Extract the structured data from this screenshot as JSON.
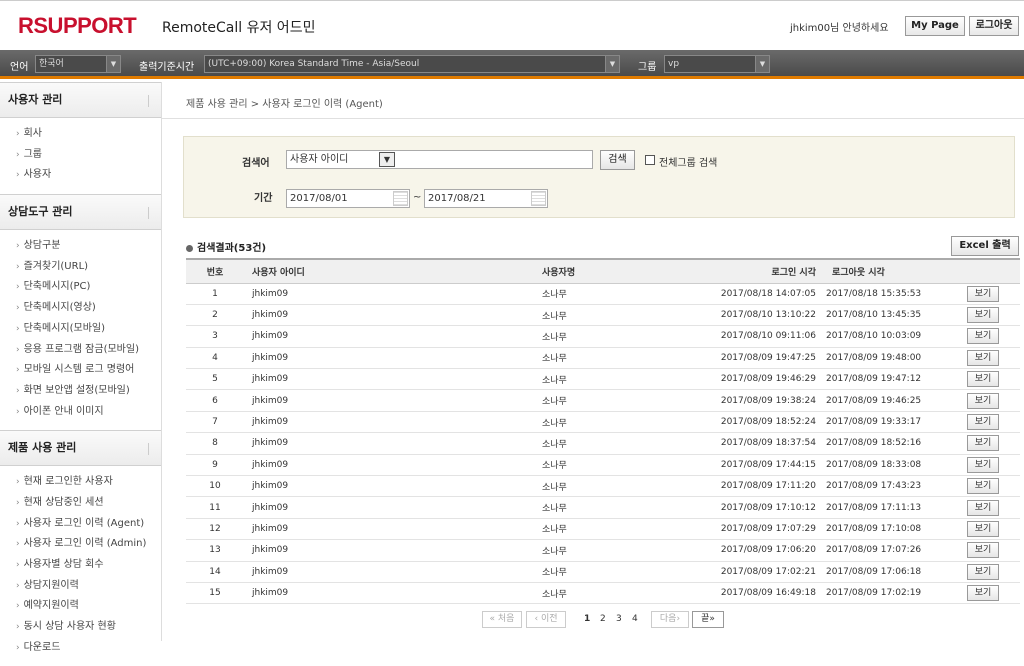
{
  "header": {
    "logo": "RSUPPORT",
    "app_title": "RemoteCall 유저 어드민",
    "greeting": "jhkim00님 안녕하세요",
    "mypage_label": "My Page",
    "logout_label": "로그아웃"
  },
  "topbar": {
    "language_label": "언어",
    "language_value": "한국어",
    "timezone_label": "출력기준시간",
    "timezone_value": "(UTC+09:00) Korea Standard Time - Asia/Seoul",
    "group_label": "그룹",
    "group_value": "vp"
  },
  "sidebar": {
    "sections": [
      {
        "title": "사용자 관리",
        "items": [
          "회사",
          "그룹",
          "사용자"
        ]
      },
      {
        "title": "상담도구 관리",
        "items": [
          "상담구분",
          "즐겨찾기(URL)",
          "단축메시지(PC)",
          "단축메시지(영상)",
          "단축메시지(모바일)",
          "응용 프로그램 잠금(모바일)",
          "모바일 시스템 로그 명령어",
          "화면 보안앱 설정(모바일)",
          "아이폰 안내 이미지"
        ]
      },
      {
        "title": "제품 사용 관리",
        "items": [
          "현재 로그인한 사용자",
          "현재 상담중인 세션",
          "사용자 로그인 이력 (Agent)",
          "사용자 로그인 이력 (Admin)",
          "사용자별 상담 회수",
          "상담지원이력",
          "예약지원이력",
          "동시 상담 사용자 현황",
          "다운로드"
        ]
      }
    ]
  },
  "breadcrumb": "제품 사용 관리 > 사용자 로그인 이력 (Agent)",
  "search": {
    "keyword_label": "검색어",
    "field_value": "사용자 아이디",
    "keyword_value": "",
    "search_button": "검색",
    "all_groups_label": "전체그룹 검색",
    "all_groups_checked": false,
    "period_label": "기간",
    "date_from": "2017/08/01",
    "date_sep": "~",
    "date_to": "2017/08/21"
  },
  "results": {
    "title": "검색결과(53건)",
    "excel_button": "Excel 출력",
    "columns": [
      "번호",
      "사용자 아이디",
      "사용자명",
      "로그인 시각",
      "로그아웃 시각",
      ""
    ],
    "view_label": "보기",
    "rows": [
      [
        "1",
        "jhkim09",
        "소나무",
        "2017/08/18 14:07:05",
        "2017/08/18 15:35:53"
      ],
      [
        "2",
        "jhkim09",
        "소나무",
        "2017/08/10 13:10:22",
        "2017/08/10 13:45:35"
      ],
      [
        "3",
        "jhkim09",
        "소나무",
        "2017/08/10 09:11:06",
        "2017/08/10 10:03:09"
      ],
      [
        "4",
        "jhkim09",
        "소나무",
        "2017/08/09 19:47:25",
        "2017/08/09 19:48:00"
      ],
      [
        "5",
        "jhkim09",
        "소나무",
        "2017/08/09 19:46:29",
        "2017/08/09 19:47:12"
      ],
      [
        "6",
        "jhkim09",
        "소나무",
        "2017/08/09 19:38:24",
        "2017/08/09 19:46:25"
      ],
      [
        "7",
        "jhkim09",
        "소나무",
        "2017/08/09 18:52:24",
        "2017/08/09 19:33:17"
      ],
      [
        "8",
        "jhkim09",
        "소나무",
        "2017/08/09 18:37:54",
        "2017/08/09 18:52:16"
      ],
      [
        "9",
        "jhkim09",
        "소나무",
        "2017/08/09 17:44:15",
        "2017/08/09 18:33:08"
      ],
      [
        "10",
        "jhkim09",
        "소나무",
        "2017/08/09 17:11:20",
        "2017/08/09 17:43:23"
      ],
      [
        "11",
        "jhkim09",
        "소나무",
        "2017/08/09 17:10:12",
        "2017/08/09 17:11:13"
      ],
      [
        "12",
        "jhkim09",
        "소나무",
        "2017/08/09 17:07:29",
        "2017/08/09 17:10:08"
      ],
      [
        "13",
        "jhkim09",
        "소나무",
        "2017/08/09 17:06:20",
        "2017/08/09 17:07:26"
      ],
      [
        "14",
        "jhkim09",
        "소나무",
        "2017/08/09 17:02:21",
        "2017/08/09 17:06:18"
      ],
      [
        "15",
        "jhkim09",
        "소나무",
        "2017/08/09 16:49:18",
        "2017/08/09 17:02:19"
      ]
    ]
  },
  "pager": {
    "first": "« 처음",
    "prev": "‹ 이전",
    "pages": [
      "1",
      "2",
      "3",
      "4"
    ],
    "current": "1",
    "next": "다음›",
    "last": "끝»"
  },
  "colors": {
    "brand": "#c8102e",
    "accent": "#e07b00"
  }
}
